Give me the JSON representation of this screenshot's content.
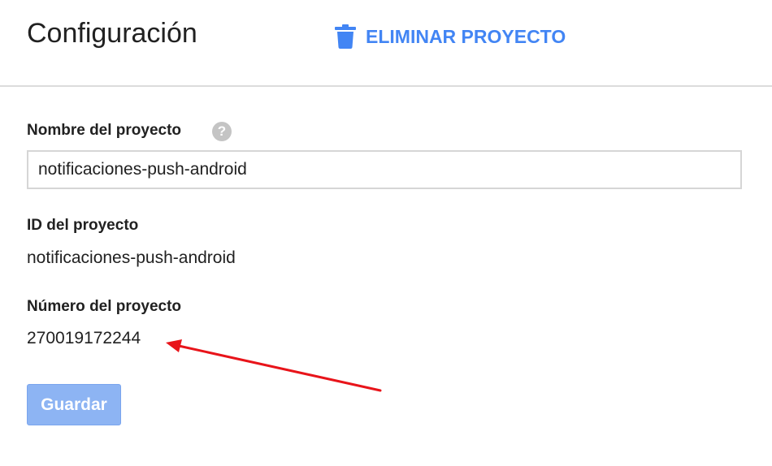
{
  "header": {
    "title": "Configuración",
    "delete_label": "ELIMINAR PROYECTO"
  },
  "form": {
    "project_name_label": "Nombre del proyecto",
    "help_glyph": "?",
    "project_name_value": "notificaciones-push-android",
    "project_id_label": "ID del proyecto",
    "project_id_value": "notificaciones-push-android",
    "project_number_label": "Número del proyecto",
    "project_number_value": "270019172244",
    "save_label": "Guardar"
  },
  "icons": {
    "delete": "trash-icon",
    "help": "help-icon"
  },
  "colors": {
    "accent": "#4285f4",
    "save_button_disabled": "#8db4f3",
    "annotation_arrow": "#e8141a"
  }
}
